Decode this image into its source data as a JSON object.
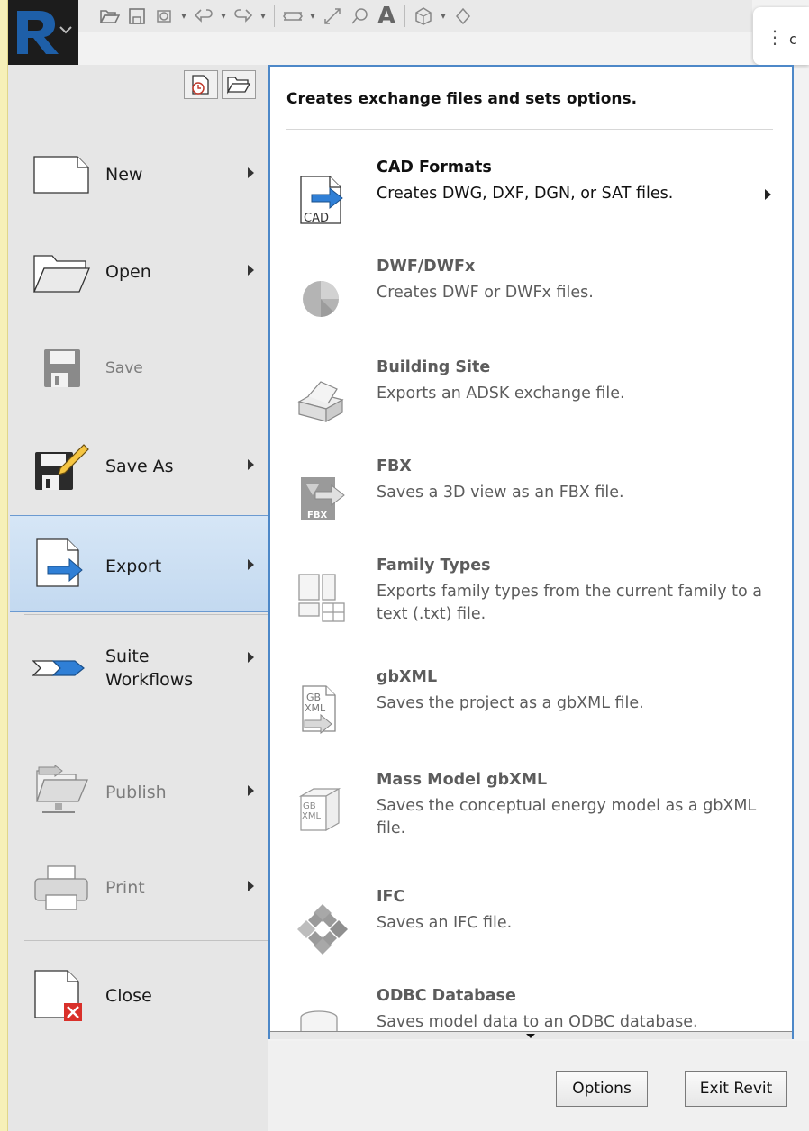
{
  "toolbar": {
    "icons": [
      "revit-logo-icon",
      "open-folder-icon",
      "save-icon",
      "sync-icon",
      "undo-icon",
      "redo-icon",
      "measure-icon",
      "dimension-icon",
      "tag-icon",
      "text-icon",
      "3d-view-icon",
      "section-icon"
    ],
    "more_dots": "⋮",
    "more_letter": "c"
  },
  "left_menu": {
    "items": [
      {
        "label": "New",
        "state": "enabled",
        "submenu": true,
        "icon": "new-document-icon"
      },
      {
        "label": "Open",
        "state": "enabled",
        "submenu": true,
        "icon": "open-folder-icon"
      },
      {
        "label": "Save",
        "state": "disabled",
        "submenu": false,
        "icon": "floppy-disk-icon"
      },
      {
        "label": "Save As",
        "state": "enabled",
        "submenu": true,
        "icon": "save-as-icon"
      },
      {
        "label": "Export",
        "state": "selected",
        "submenu": true,
        "icon": "export-document-icon"
      },
      {
        "label_line1": "Suite",
        "label_line2": "Workflows",
        "state": "enabled",
        "submenu": true,
        "icon": "suite-workflows-icon"
      },
      {
        "label": "Publish",
        "state": "disabled",
        "submenu": true,
        "icon": "publish-icon"
      },
      {
        "label": "Print",
        "state": "disabled",
        "submenu": true,
        "icon": "printer-icon"
      },
      {
        "label": "Close",
        "state": "enabled",
        "submenu": false,
        "icon": "close-document-icon"
      }
    ]
  },
  "export_panel": {
    "heading": "Creates exchange files and sets options.",
    "items": [
      {
        "title": "CAD Formats",
        "desc": "Creates DWG, DXF, DGN, or SAT files.",
        "state": "enabled",
        "submenu": true,
        "icon": "cad-formats-icon"
      },
      {
        "title": "DWF/DWFx",
        "desc": "Creates DWF or DWFx files.",
        "state": "disabled",
        "submenu": false,
        "icon": "dwf-sphere-icon"
      },
      {
        "title": "Building Site",
        "desc": "Exports an ADSK exchange file.",
        "state": "disabled",
        "submenu": false,
        "icon": "building-site-icon"
      },
      {
        "title": "FBX",
        "desc": "Saves a 3D view as an FBX file.",
        "state": "disabled",
        "submenu": false,
        "icon": "fbx-icon"
      },
      {
        "title": "Family Types",
        "desc": "Exports family types from the current family to a text (.txt) file.",
        "state": "disabled",
        "submenu": false,
        "icon": "family-types-icon"
      },
      {
        "title": "gbXML",
        "desc": "Saves the project as a gbXML file.",
        "state": "disabled",
        "submenu": false,
        "icon": "gbxml-icon"
      },
      {
        "title": "Mass Model gbXML",
        "desc": "Saves the conceptual energy model as a gbXML file.",
        "state": "disabled",
        "submenu": false,
        "icon": "mass-model-gbxml-icon"
      },
      {
        "title": "IFC",
        "desc": "Saves an IFC file.",
        "state": "disabled",
        "submenu": false,
        "icon": "ifc-icon"
      },
      {
        "title": "ODBC Database",
        "desc": "Saves model data to an ODBC database.",
        "state": "disabled",
        "submenu": false,
        "icon": "odbc-database-icon"
      }
    ]
  },
  "buttons": {
    "options": "Options",
    "exit": "Exit Revit"
  },
  "icon_text": {
    "cad": "CAD",
    "fbx": "FBX",
    "gb": "GB",
    "xml": "XML"
  }
}
